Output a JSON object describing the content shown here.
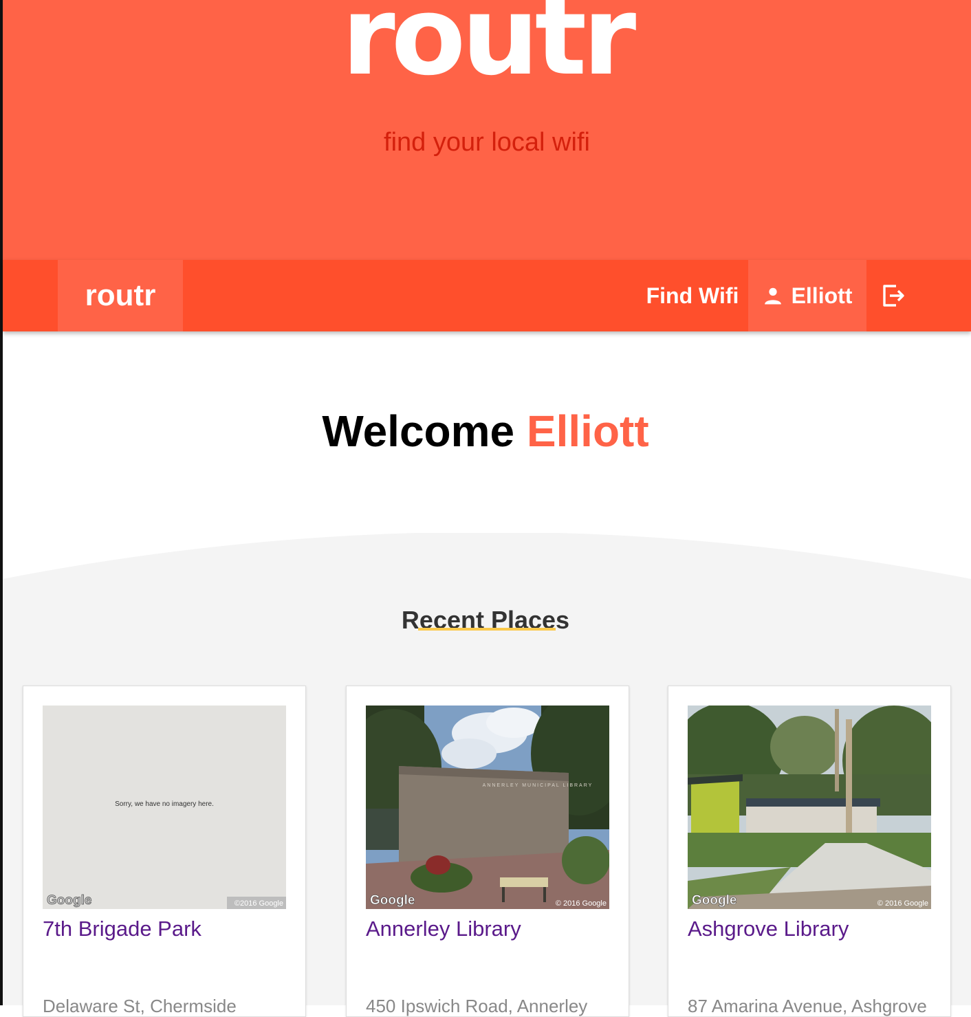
{
  "hero": {
    "title": "routr",
    "subtitle": "find your local wifi"
  },
  "navbar": {
    "brand": "routr",
    "find_wifi": "Find Wifi",
    "user": "Elliott",
    "user_icon": "person-icon",
    "logout_icon": "logout-icon"
  },
  "welcome": {
    "greeting": "Welcome",
    "name": "Elliott"
  },
  "recent": {
    "title": "Recent Places",
    "places": [
      {
        "name": "7th Brigade Park",
        "address": "Delaware St, Chermside",
        "image": {
          "no_imagery_text": "Sorry, we have no imagery here.",
          "watermark": "Google",
          "copyright": "©2016 Google"
        }
      },
      {
        "name": "Annerley Library",
        "address": "450 Ipswich Road, Annerley",
        "image": {
          "sign_text": "ANNERLEY MUNICIPAL LIBRARY",
          "watermark": "Google",
          "copyright": "© 2016 Google"
        }
      },
      {
        "name": "Ashgrove Library",
        "address": "87 Amarina Avenue, Ashgrove",
        "image": {
          "watermark": "Google",
          "copyright": "© 2016 Google"
        }
      }
    ]
  },
  "colors": {
    "hero_bg": "#ff6347",
    "navbar_bg": "#ff4f2c",
    "accent": "#ff6347",
    "subtitle": "#d4200c",
    "title_link": "#5a1a8a",
    "underline": "#fbc94a",
    "section_bg": "#f4f4f4"
  }
}
